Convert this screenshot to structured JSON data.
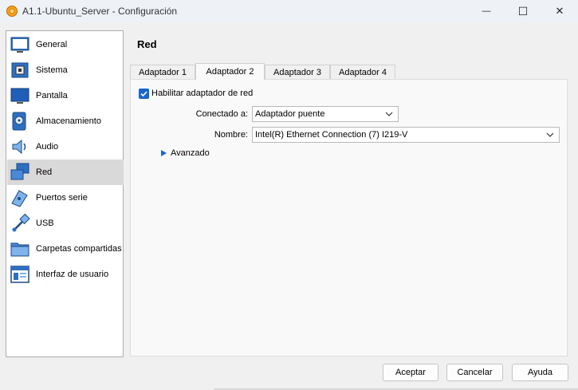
{
  "window": {
    "title": "A1.1-Ubuntu_Server - Configuración",
    "minimize_glyph": "—",
    "maximize_glyph": "☐",
    "close_glyph": "✕"
  },
  "sidebar": {
    "items": [
      {
        "label": "General",
        "icon": "general-icon"
      },
      {
        "label": "Sistema",
        "icon": "system-icon"
      },
      {
        "label": "Pantalla",
        "icon": "display-icon"
      },
      {
        "label": "Almacenamiento",
        "icon": "storage-icon"
      },
      {
        "label": "Audio",
        "icon": "audio-icon"
      },
      {
        "label": "Red",
        "icon": "network-icon",
        "selected": true
      },
      {
        "label": "Puertos serie",
        "icon": "serial-ports-icon"
      },
      {
        "label": "USB",
        "icon": "usb-icon"
      },
      {
        "label": "Carpetas compartidas",
        "icon": "shared-folders-icon"
      },
      {
        "label": "Interfaz de usuario",
        "icon": "user-interface-icon"
      }
    ]
  },
  "main": {
    "section_title": "Red",
    "tabs": [
      {
        "label": "Adaptador 1"
      },
      {
        "label": "Adaptador 2",
        "active": true
      },
      {
        "label": "Adaptador 3"
      },
      {
        "label": "Adaptador 4"
      }
    ],
    "enable_adapter": {
      "label": "Habilitar adaptador de red",
      "checked": true
    },
    "attached_to": {
      "label": "Conectado a:",
      "value": "Adaptador puente"
    },
    "name": {
      "label": "Nombre:",
      "value": "Intel(R) Ethernet Connection (7) I219-V"
    },
    "advanced": {
      "label": "Avanzado"
    }
  },
  "buttons": {
    "accept": "Aceptar",
    "cancel": "Cancelar",
    "help": "Ayuda"
  },
  "colors": {
    "accent": "#1a66cc",
    "selected_item_bg": "#d9d9d9"
  }
}
